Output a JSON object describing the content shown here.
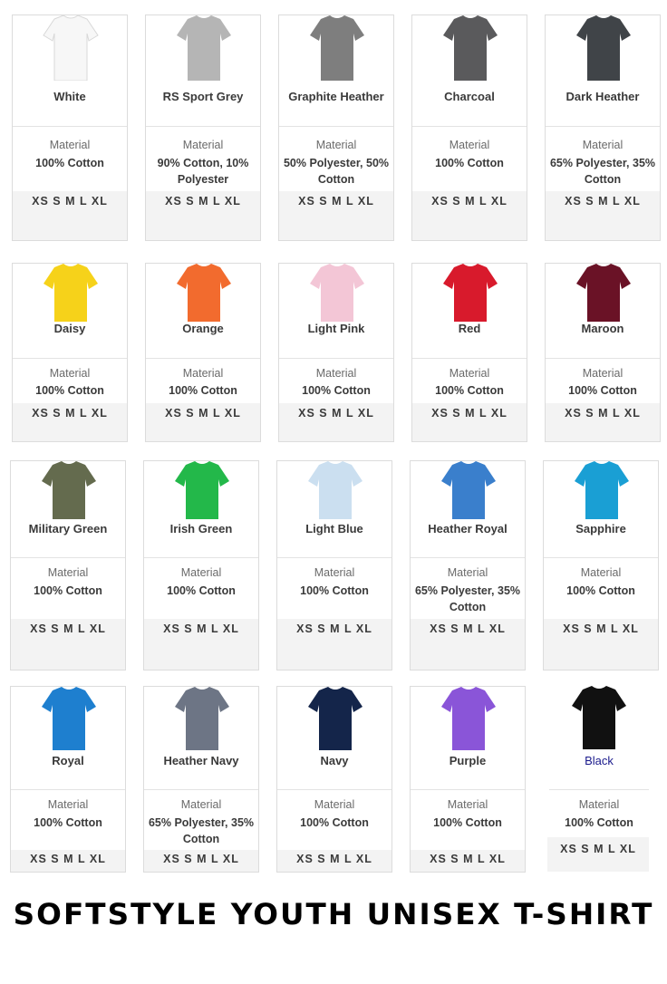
{
  "page_title": "SOFTSTYLE YOUTH UNISEX T-SHIRT",
  "material_label": "Material",
  "products": [
    {
      "name": "White",
      "material": "100% Cotton",
      "sizes": "XS S M L XL",
      "color": "#f7f7f7",
      "icon": "tshirt-icon"
    },
    {
      "name": "RS Sport Grey",
      "material": "90% Cotton, 10% Polyester",
      "sizes": "XS S M L XL",
      "color": "#b5b5b5",
      "icon": "tshirt-icon"
    },
    {
      "name": "Graphite Heather",
      "material": "50% Polyester, 50% Cotton",
      "sizes": "XS S M L XL",
      "color": "#7e7e7e",
      "icon": "tshirt-icon"
    },
    {
      "name": "Charcoal",
      "material": "100% Cotton",
      "sizes": "XS S M L XL",
      "color": "#5a5a5c",
      "icon": "tshirt-icon"
    },
    {
      "name": "Dark Heather",
      "material": "65% Polyester, 35% Cotton",
      "sizes": "XS S M L XL",
      "color": "#404448",
      "icon": "tshirt-icon"
    },
    {
      "name": "Daisy",
      "material": "100% Cotton",
      "sizes": "XS S M L XL",
      "color": "#f6d21a",
      "icon": "tshirt-icon"
    },
    {
      "name": "Orange",
      "material": "100% Cotton",
      "sizes": "XS S M L XL",
      "color": "#f26b2e",
      "icon": "tshirt-icon"
    },
    {
      "name": "Light Pink",
      "material": "100% Cotton",
      "sizes": "XS S M L XL",
      "color": "#f3c6d6",
      "icon": "tshirt-icon"
    },
    {
      "name": "Red",
      "material": "100% Cotton",
      "sizes": "XS S M L XL",
      "color": "#d81a2c",
      "icon": "tshirt-icon"
    },
    {
      "name": "Maroon",
      "material": "100% Cotton",
      "sizes": "XS S M L XL",
      "color": "#6a1226",
      "icon": "tshirt-icon"
    },
    {
      "name": "Military Green",
      "material": "100% Cotton",
      "sizes": "XS S M L XL",
      "color": "#646b4e",
      "icon": "tshirt-icon"
    },
    {
      "name": "Irish Green",
      "material": "100% Cotton",
      "sizes": "XS S M L XL",
      "color": "#23b84a",
      "icon": "tshirt-icon"
    },
    {
      "name": "Light Blue",
      "material": "100% Cotton",
      "sizes": "XS S M L XL",
      "color": "#cbdff0",
      "icon": "tshirt-icon"
    },
    {
      "name": "Heather Royal",
      "material": "65% Polyester, 35% Cotton",
      "sizes": "XS S M L XL",
      "color": "#3a7fcc",
      "icon": "tshirt-icon"
    },
    {
      "name": "Sapphire",
      "material": "100% Cotton",
      "sizes": "XS S M L XL",
      "color": "#1a9fd4",
      "icon": "tshirt-icon"
    },
    {
      "name": "Royal",
      "material": "100% Cotton",
      "sizes": "XS S M L XL",
      "color": "#1e7fcf",
      "icon": "tshirt-icon"
    },
    {
      "name": "Heather Navy",
      "material": "65% Polyester, 35% Cotton",
      "sizes": "XS S M L XL",
      "color": "#6d7585",
      "icon": "tshirt-icon"
    },
    {
      "name": "Navy",
      "material": "100% Cotton",
      "sizes": "XS S M L XL",
      "color": "#14254a",
      "icon": "tshirt-icon"
    },
    {
      "name": "Purple",
      "material": "100% Cotton",
      "sizes": "XS S M L XL",
      "color": "#8a55d8",
      "icon": "tshirt-icon"
    },
    {
      "name": "Black",
      "material": "100% Cotton",
      "sizes": "XS S M L XL",
      "color": "#111111",
      "icon": "tshirt-icon"
    }
  ]
}
